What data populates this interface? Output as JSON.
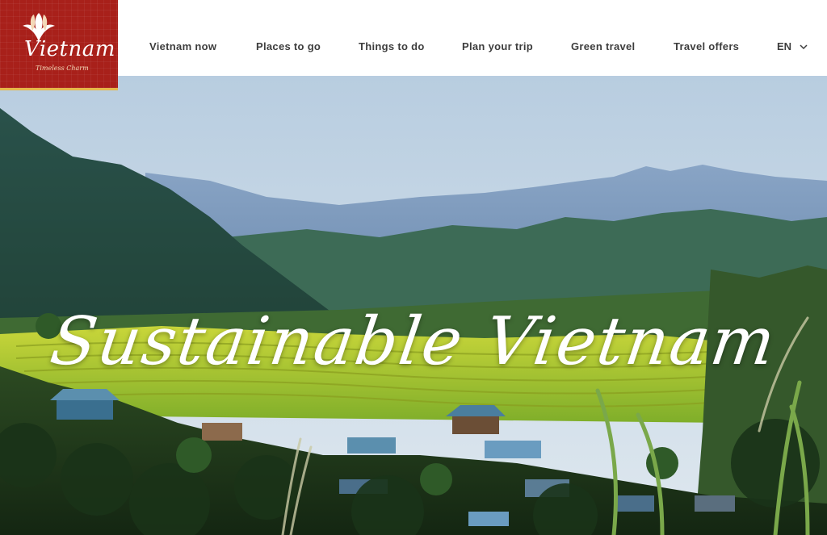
{
  "brand": {
    "name": "Vietnam",
    "tagline": "Timeless Charm",
    "background_color": "#a8201a",
    "accent_color": "#e6b84a"
  },
  "nav": {
    "items": [
      {
        "label": "Vietnam now"
      },
      {
        "label": "Places to go"
      },
      {
        "label": "Things to do"
      },
      {
        "label": "Plan your trip"
      },
      {
        "label": "Green travel"
      },
      {
        "label": "Travel offers"
      }
    ],
    "language": {
      "label": "EN",
      "icon": "chevron-down-icon"
    }
  },
  "hero": {
    "title": "Sustainable Vietnam",
    "image": "mountain valley with terraced rice fields and village"
  }
}
